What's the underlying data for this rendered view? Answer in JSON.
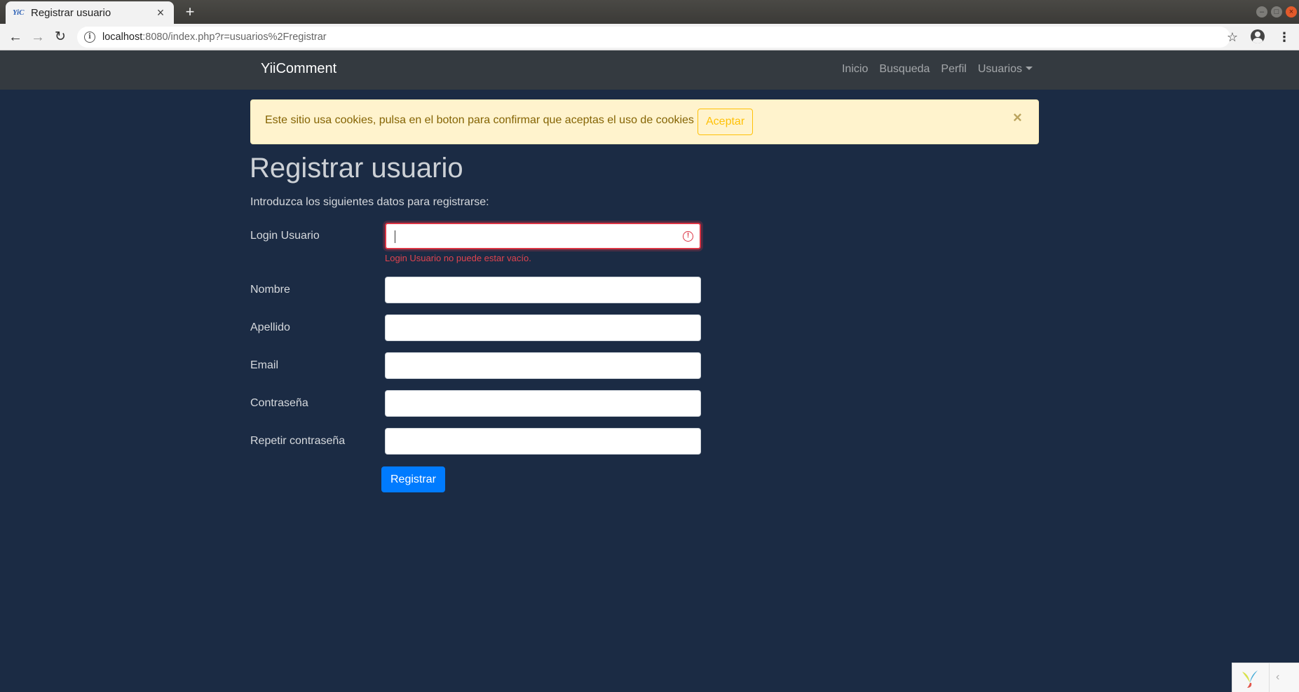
{
  "browser": {
    "tab_title": "Registrar usuario",
    "tab_favicon": "YiC",
    "new_tab_label": "+",
    "url_host": "localhost",
    "url_path": ":8080/index.php?r=usuarios%2Fregistrar"
  },
  "navbar": {
    "brand": "YiiComment",
    "links": [
      "Inicio",
      "Busqueda",
      "Perfil",
      "Usuarios"
    ]
  },
  "alert": {
    "message": "Este sitio usa cookies, pulsa en el boton para confirmar que aceptas el uso de cookies",
    "accept_label": "Aceptar",
    "close_label": "×"
  },
  "form": {
    "title": "Registrar usuario",
    "intro": "Introduzca los siguientes datos para registrarse:",
    "fields": [
      {
        "label": "Login Usuario",
        "value": "",
        "error": "Login Usuario no puede estar vacío."
      },
      {
        "label": "Nombre",
        "value": ""
      },
      {
        "label": "Apellido",
        "value": ""
      },
      {
        "label": "Email",
        "value": ""
      },
      {
        "label": "Contraseña",
        "value": ""
      },
      {
        "label": "Repetir contraseña",
        "value": ""
      }
    ],
    "submit_label": "Registrar"
  },
  "debug": {
    "toggle_label": "‹"
  },
  "colors": {
    "page_bg": "#1b2b44",
    "navbar_bg": "#343a40",
    "alert_bg": "#fff3cd",
    "alert_text": "#856404",
    "accept_border": "#ffc107",
    "error": "#dc3545",
    "primary": "#007bff"
  }
}
